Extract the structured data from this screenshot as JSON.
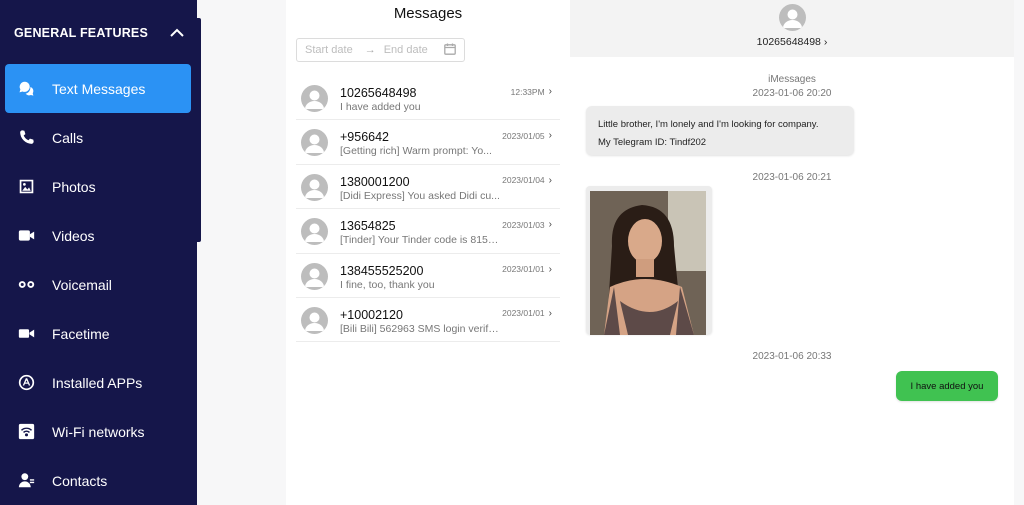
{
  "sidebar": {
    "header": "GENERAL FEATURES",
    "items": [
      {
        "label": "Text Messages",
        "icon": "chat-bubbles-icon",
        "active": true
      },
      {
        "label": "Calls",
        "icon": "phone-icon"
      },
      {
        "label": "Photos",
        "icon": "photo-icon"
      },
      {
        "label": "Videos",
        "icon": "video-camera-icon"
      },
      {
        "label": "Voicemail",
        "icon": "voicemail-icon"
      },
      {
        "label": "Facetime",
        "icon": "facetime-icon"
      },
      {
        "label": "Installed APPs",
        "icon": "app-store-icon"
      },
      {
        "label": "Wi-Fi networks",
        "icon": "wifi-icon"
      },
      {
        "label": "Contacts",
        "icon": "contacts-icon"
      }
    ]
  },
  "conversations": {
    "title": "Messages",
    "start_date_placeholder": "Start date",
    "arrow": "→",
    "end_date_placeholder": "End date",
    "items": [
      {
        "name": "10265648498",
        "preview": "I have added you",
        "time": "12:33PM"
      },
      {
        "name": "+956642",
        "preview": "[Getting rich] Warm prompt: Yo...",
        "time": "2023/01/05"
      },
      {
        "name": "1380001200",
        "preview": "[Didi Express] You asked Didi cu...",
        "time": "2023/01/04"
      },
      {
        "name": "13654825",
        "preview": "[Tinder] Your Tinder code is 8151...",
        "time": "2023/01/03"
      },
      {
        "name": "138455525200",
        "preview": "I fine, too, thank you",
        "time": "2023/01/01"
      },
      {
        "name": "+10002120",
        "preview": "[Bili Bili] 562963 SMS login verific...",
        "time": "2023/01/01"
      }
    ]
  },
  "chat": {
    "contact": "10265648498",
    "chevron": "›",
    "service": "iMessages",
    "time1": "2023-01-06 20:20",
    "msg1_line1": "Little brother, I'm lonely and I'm looking for company.",
    "msg1_line2": "My Telegram ID: Tindf202",
    "time2": "2023-01-06 20:21",
    "time3": "2023-01-06 20:33",
    "msg3": "I have added you"
  },
  "colors": {
    "sidebar_bg": "#15164a",
    "active_item": "#2b92f4",
    "outgoing_bubble": "#40c251",
    "incoming_bubble": "#ececec"
  }
}
